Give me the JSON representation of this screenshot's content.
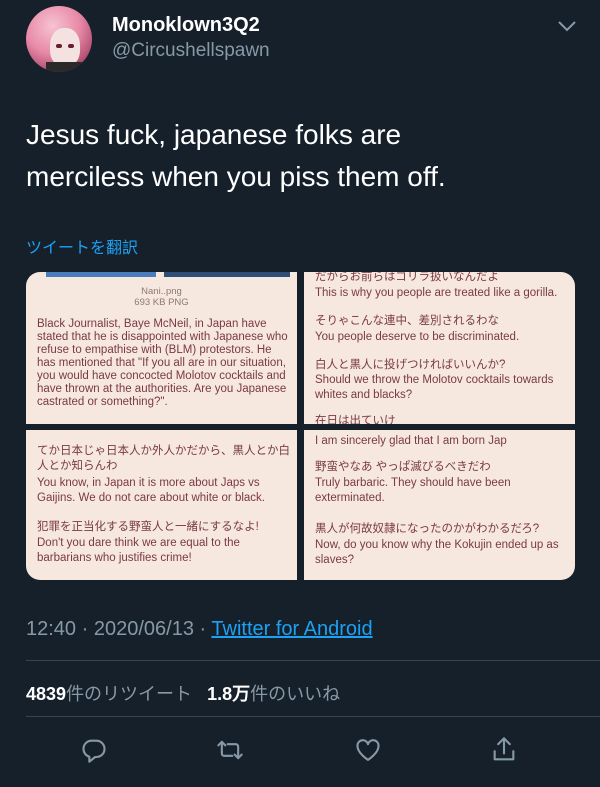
{
  "user": {
    "display_name": "Monoklown3Q2",
    "handle": "@Circushellspawn"
  },
  "tweet": {
    "text_line1": "Jesus fuck, japanese folks are",
    "text_line2": "merciless when you piss them off.",
    "translate_label": "ツイートを翻訳"
  },
  "media": {
    "img1": {
      "file_name": "Nani..png",
      "file_size": "693 KB PNG",
      "body": "Black Journalist, Baye McNeil, in Japan have stated that he is disappointed with Japanese who refuse to empathise with (BLM) protestors. He has mentioned that \"If you all are in our situation, you would have concocted Molotov cocktails and have thrown at the authorities. Are you Japanese castrated or something?\"."
    },
    "img2": {
      "jp1": "だからお前らはゴリラ扱いなんだよ",
      "en1": "This is why you people are treated like a gorilla.",
      "jp2": "そりゃこんな連中、差別されるわな",
      "en2": "You people deserve to be discriminated.",
      "jp3": "白人と黒人に投げつければいいんか?",
      "en3": "Should we throw the Molotov cocktails towards whites and blacks?",
      "jp4": "在日は出ていけ"
    },
    "img3": {
      "jp1": "てか日本じゃ日本人か外人かだから、黒人とか白人とか知らんわ",
      "en1": "You know, in Japan it is more about Japs vs Gaijins. We do not care about white or black.",
      "jp2": "犯罪を正当化する野蛮人と一緒にするなよ!",
      "en2": "Don't you dare think we are equal to the barbarians who justifies crime!"
    },
    "img4": {
      "en0": "I am sincerely glad that I am born Jap",
      "jp1": "野蛮やなあ やっぱ滅びるべきだわ",
      "en1": "Truly barbaric. They should have been exterminated.",
      "jp2": "黒人が何故奴隷になったのかがわかるだろ?",
      "en2": "Now, do you know why the Kokujin ended up as slaves?"
    }
  },
  "meta": {
    "time": "12:40",
    "date": "2020/06/13",
    "separator": "·",
    "source": "Twitter for Android"
  },
  "stats": {
    "retweet_count": "4839",
    "retweet_label": "件のリツイート",
    "like_count": "1.8万",
    "like_label": "件のいいね"
  },
  "icons": {
    "more": "chevron-down-icon",
    "reply": "reply-icon",
    "retweet": "retweet-icon",
    "like": "like-icon",
    "share": "share-icon"
  },
  "colors": {
    "background": "#15202b",
    "accent": "#1da1f2",
    "secondary_text": "#8899a6",
    "divider": "#38444d",
    "screenshot_bg": "#f6e7df",
    "screenshot_text": "#7a3a45"
  }
}
